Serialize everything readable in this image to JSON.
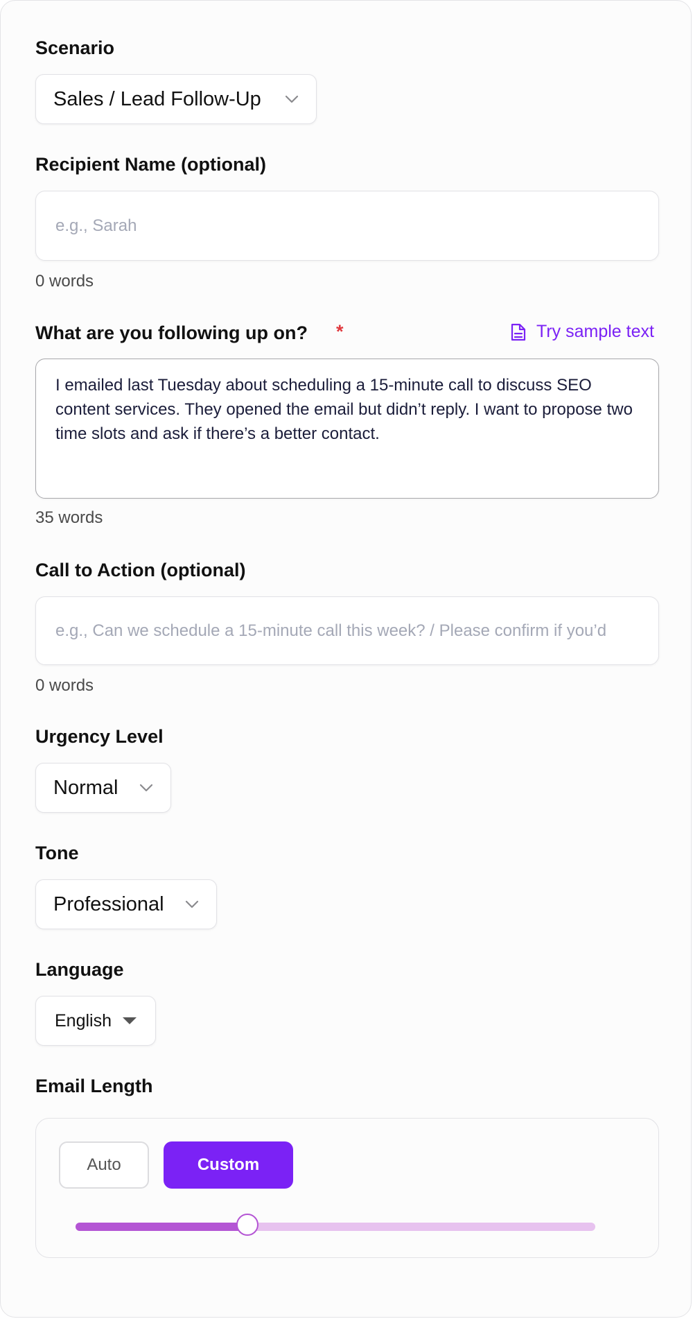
{
  "scenario": {
    "label": "Scenario",
    "value": "Sales / Lead Follow-Up"
  },
  "recipient": {
    "label": "Recipient Name (optional)",
    "placeholder": "e.g., Sarah",
    "value": "",
    "count": "0 words"
  },
  "followup": {
    "label": "What are you following up on?",
    "required_mark": "*",
    "sample_link": "Try sample text",
    "value": "I emailed last Tuesday about scheduling a 15-minute call to discuss SEO content services. They opened the email but didn’t reply. I want to propose two time slots and ask if there’s a better contact.",
    "count": "35 words"
  },
  "cta": {
    "label": "Call to Action (optional)",
    "placeholder": "e.g., Can we schedule a 15-minute call this week? / Please confirm if you’d",
    "value": "",
    "count": "0 words"
  },
  "urgency": {
    "label": "Urgency Level",
    "value": "Normal"
  },
  "tone": {
    "label": "Tone",
    "value": "Professional"
  },
  "language": {
    "label": "Language",
    "value": "English"
  },
  "length": {
    "label": "Email Length",
    "auto_label": "Auto",
    "custom_label": "Custom",
    "selected": "Custom",
    "slider_fraction": 0.33
  },
  "colors": {
    "accent": "#7b22f5",
    "required": "#e0393e",
    "slider_fill": "#b455d4",
    "slider_track": "#e7c2ef"
  }
}
